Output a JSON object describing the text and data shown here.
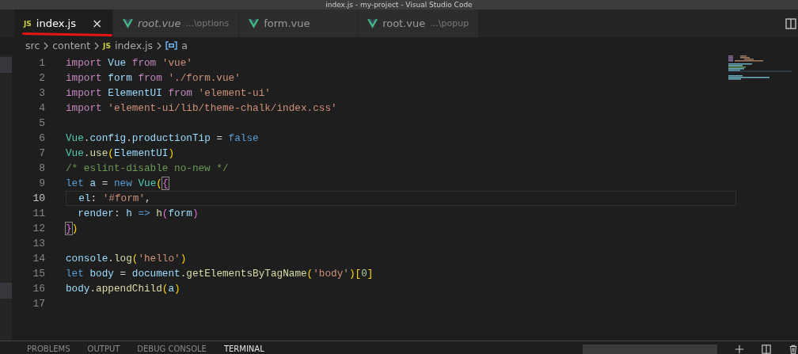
{
  "window": {
    "title": "index.js - my-project - Visual Studio Code"
  },
  "tabs": [
    {
      "label": "index.js",
      "kind": "js",
      "icon_text": "JS",
      "selected": true,
      "preview": false,
      "close": "×"
    },
    {
      "label": "root.vue",
      "kind": "vue",
      "selected": false,
      "preview": true,
      "description": "...\\options"
    },
    {
      "label": "form.vue",
      "kind": "vue",
      "selected": false,
      "preview": false
    },
    {
      "label": "root.vue",
      "kind": "vue",
      "selected": false,
      "preview": false,
      "description": "...\\popup"
    }
  ],
  "breadcrumb": [
    {
      "label": "src",
      "kind": "folder"
    },
    {
      "label": "content",
      "kind": "folder"
    },
    {
      "label": "index.js",
      "kind": "js",
      "icon_text": "JS"
    },
    {
      "label": "a",
      "kind": "symbol"
    }
  ],
  "editor": {
    "lines": [
      {
        "number": "1",
        "current": false,
        "tokens": [
          {
            "text": "import ",
            "kind": "kw"
          },
          {
            "text": "Vue ",
            "kind": "var"
          },
          {
            "text": "from ",
            "kind": "kw"
          },
          {
            "text": "'vue'",
            "kind": "str"
          }
        ]
      },
      {
        "number": "2",
        "current": false,
        "tokens": [
          {
            "text": "import ",
            "kind": "kw"
          },
          {
            "text": "form ",
            "kind": "var"
          },
          {
            "text": "from ",
            "kind": "kw"
          },
          {
            "text": "'./form.vue'",
            "kind": "str"
          }
        ]
      },
      {
        "number": "3",
        "current": false,
        "tokens": [
          {
            "text": "import ",
            "kind": "kw"
          },
          {
            "text": "ElementUI ",
            "kind": "var"
          },
          {
            "text": "from ",
            "kind": "kw"
          },
          {
            "text": "'element-ui'",
            "kind": "str"
          }
        ]
      },
      {
        "number": "4",
        "current": false,
        "tokens": [
          {
            "text": "import ",
            "kind": "kw"
          },
          {
            "text": "'element-ui/lib/theme-chalk/index.css'",
            "kind": "str"
          }
        ]
      },
      {
        "number": "5",
        "current": false
      },
      {
        "number": "6",
        "current": false,
        "tokens": [
          {
            "text": "Vue",
            "kind": "cls"
          },
          {
            "text": ".",
            "kind": "plain"
          },
          {
            "text": "config",
            "kind": "var"
          },
          {
            "text": ".",
            "kind": "plain"
          },
          {
            "text": "productionTip",
            "kind": "var"
          },
          {
            "text": " = ",
            "kind": "plain"
          },
          {
            "text": "false",
            "kind": "const"
          }
        ]
      },
      {
        "number": "7",
        "current": false,
        "tokens": [
          {
            "text": "Vue",
            "kind": "cls"
          },
          {
            "text": ".",
            "kind": "plain"
          },
          {
            "text": "use",
            "kind": "fn"
          },
          {
            "text": "(",
            "kind": "br"
          },
          {
            "text": "ElementUI",
            "kind": "var"
          },
          {
            "text": ")",
            "kind": "br"
          }
        ]
      },
      {
        "number": "8",
        "current": false,
        "tokens": [
          {
            "text": "/* eslint-disable no-new */",
            "kind": "comment"
          }
        ]
      },
      {
        "number": "9",
        "current": false,
        "tokens": [
          {
            "text": "let ",
            "kind": "const"
          },
          {
            "text": "a",
            "kind": "var"
          },
          {
            "text": " = ",
            "kind": "plain"
          },
          {
            "text": "new ",
            "kind": "const"
          },
          {
            "text": "Vue",
            "kind": "cls"
          },
          {
            "text": "(",
            "kind": "br"
          },
          {
            "text": "{",
            "kind": "brm"
          }
        ]
      },
      {
        "number": "10",
        "current": true,
        "tokens": [
          {
            "text": "  el",
            "kind": "var"
          },
          {
            "text": ": ",
            "kind": "plain"
          },
          {
            "text": "'#form'",
            "kind": "str"
          },
          {
            "text": ",",
            "kind": "plain"
          }
        ]
      },
      {
        "number": "11",
        "current": false,
        "tokens": [
          {
            "text": "  render",
            "kind": "var"
          },
          {
            "text": ": ",
            "kind": "plain"
          },
          {
            "text": "h ",
            "kind": "var"
          },
          {
            "text": "=> ",
            "kind": "const"
          },
          {
            "text": "h",
            "kind": "fn"
          },
          {
            "text": "(",
            "kind": "br2"
          },
          {
            "text": "form",
            "kind": "var"
          },
          {
            "text": ")",
            "kind": "br2"
          }
        ]
      },
      {
        "number": "12",
        "current": false,
        "tokens": [
          {
            "text": "}",
            "kind": "brm"
          },
          {
            "text": ")",
            "kind": "br"
          }
        ]
      },
      {
        "number": "13",
        "current": false
      },
      {
        "number": "14",
        "current": false,
        "tokens": [
          {
            "text": "console",
            "kind": "var"
          },
          {
            "text": ".",
            "kind": "plain"
          },
          {
            "text": "log",
            "kind": "fn"
          },
          {
            "text": "(",
            "kind": "br"
          },
          {
            "text": "'hello'",
            "kind": "str"
          },
          {
            "text": ")",
            "kind": "br"
          }
        ]
      },
      {
        "number": "15",
        "current": false,
        "tokens": [
          {
            "text": "let ",
            "kind": "const"
          },
          {
            "text": "body",
            "kind": "var"
          },
          {
            "text": " = ",
            "kind": "plain"
          },
          {
            "text": "document",
            "kind": "var"
          },
          {
            "text": ".",
            "kind": "plain"
          },
          {
            "text": "getElementsByTagName",
            "kind": "fn"
          },
          {
            "text": "(",
            "kind": "br"
          },
          {
            "text": "'body'",
            "kind": "str"
          },
          {
            "text": ")",
            "kind": "br"
          },
          {
            "text": "[",
            "kind": "br"
          },
          {
            "text": "0",
            "kind": "num"
          },
          {
            "text": "]",
            "kind": "br"
          }
        ]
      },
      {
        "number": "16",
        "current": false,
        "tokens": [
          {
            "text": "body",
            "kind": "var"
          },
          {
            "text": ".",
            "kind": "plain"
          },
          {
            "text": "appendChild",
            "kind": "fn"
          },
          {
            "text": "(",
            "kind": "br"
          },
          {
            "text": "a",
            "kind": "var"
          },
          {
            "text": ")",
            "kind": "br"
          }
        ]
      },
      {
        "number": "17",
        "current": false
      }
    ]
  },
  "panel": {
    "tabs": [
      {
        "label": "PROBLEMS",
        "selected": false
      },
      {
        "label": "OUTPUT",
        "selected": false
      },
      {
        "label": "DEBUG CONSOLE",
        "selected": false
      },
      {
        "label": "TERMINAL",
        "selected": true
      }
    ]
  }
}
